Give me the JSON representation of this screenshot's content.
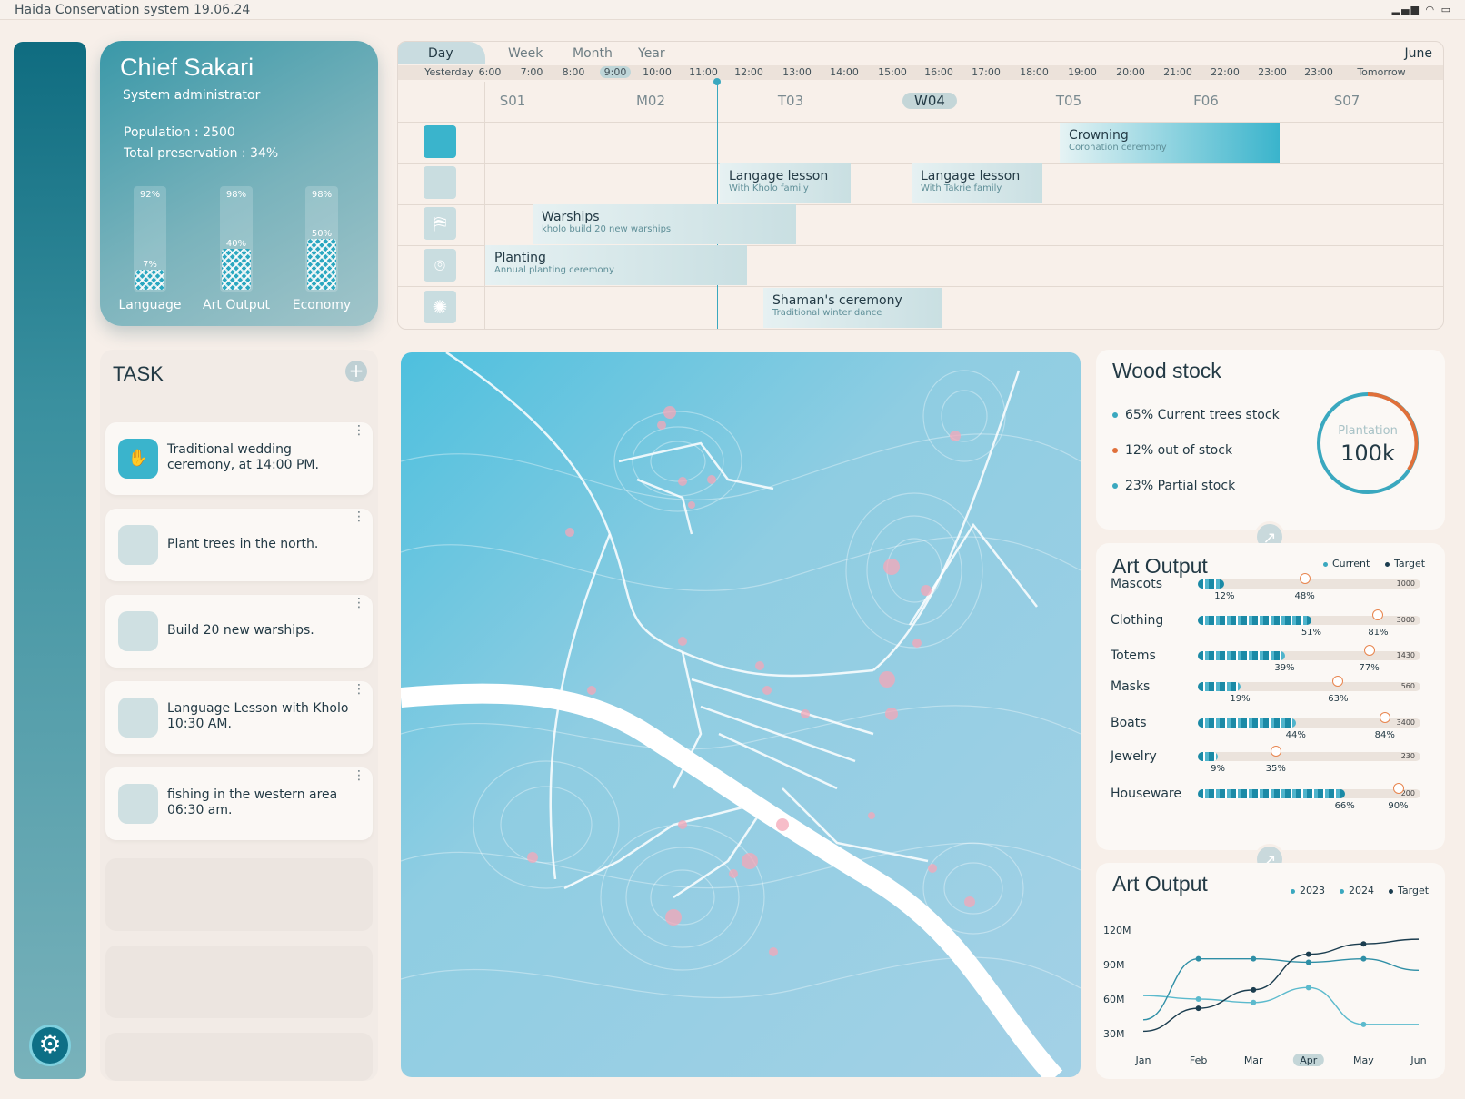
{
  "app_title": "Haida Conservation system 19.06.24",
  "profile": {
    "name": "Chief Sakari",
    "role": "System administrator",
    "population": "Population : 2500",
    "preservation": "Total preservation : 34%",
    "stats": [
      {
        "label": "Language",
        "top": "92%",
        "value": "7%",
        "fill": 7
      },
      {
        "label": "Art Output",
        "top": "98%",
        "value": "40%",
        "fill": 40
      },
      {
        "label": "Economy",
        "top": "98%",
        "value": "50%",
        "fill": 50
      }
    ]
  },
  "timeline": {
    "tabs": [
      "Day",
      "Week",
      "Month",
      "Year"
    ],
    "month": "June",
    "hours": [
      "Yesterday",
      "6:00",
      "7:00",
      "8:00",
      "9:00",
      "10:00",
      "11:00",
      "12:00",
      "13:00",
      "14:00",
      "15:00",
      "16:00",
      "17:00",
      "18:00",
      "19:00",
      "20:00",
      "21:00",
      "22:00",
      "23:00",
      "23:00",
      "Tomorrow"
    ],
    "active_hour": "9:00",
    "days": [
      "S01",
      "M02",
      "T03",
      "W04",
      "T05",
      "F06",
      "S07"
    ],
    "active_day": "W04",
    "events": [
      {
        "title": "Crowning",
        "sub": "Coronation ceremony"
      },
      {
        "title": "Langage lesson",
        "sub": "With Kholo family"
      },
      {
        "title": "Langage lesson",
        "sub": "With Takrie family"
      },
      {
        "title": "Warships",
        "sub": "kholo build 20 new warships"
      },
      {
        "title": "Planting",
        "sub": "Annual planting ceremony"
      },
      {
        "title": "Shaman's ceremony",
        "sub": "Traditional winter dance"
      }
    ]
  },
  "tasks": {
    "title": "TASK",
    "items": [
      "Traditional wedding ceremony, at 14:00 PM.",
      "Plant trees in the north.",
      "Build 20 new warships.",
      "Language Lesson with Kholo 10:30 AM.",
      "fishing in the western area 06:30 am."
    ]
  },
  "wood": {
    "title": "Wood stock",
    "items": [
      {
        "pct": "65%",
        "label": "Current trees stock",
        "color": "#3aa8bf"
      },
      {
        "pct": "12%",
        "label": "out of stock",
        "color": "#e0703a"
      },
      {
        "pct": "23%",
        "label": "Partial stock",
        "color": "#3aa8bf"
      }
    ],
    "ring_label": "Plantation",
    "ring_value": "100k"
  },
  "art_output": {
    "title": "Art Output",
    "legend_current": "Current",
    "legend_target": "Target",
    "rows": [
      {
        "label": "Mascots",
        "current": "12%",
        "target": "48%",
        "max": "1000",
        "c": 12,
        "t": 48
      },
      {
        "label": "Clothing",
        "current": "51%",
        "target": "81%",
        "max": "3000",
        "c": 51,
        "t": 81
      },
      {
        "label": "Totems",
        "current": "39%",
        "target": "77%",
        "max": "1430",
        "c": 39,
        "t": 77
      },
      {
        "label": "Masks",
        "current": "19%",
        "target": "63%",
        "max": "560",
        "c": 19,
        "t": 63
      },
      {
        "label": "Boats",
        "current": "44%",
        "target": "84%",
        "max": "3400",
        "c": 44,
        "t": 84
      },
      {
        "label": "Jewelry",
        "current": "9%",
        "target": "35%",
        "max": "230",
        "c": 9,
        "t": 35
      },
      {
        "label": "Houseware",
        "current": "66%",
        "target": "90%",
        "max": "200",
        "c": 66,
        "t": 90
      }
    ]
  },
  "art_chart": {
    "title": "Art Output",
    "legend": [
      "2023",
      "2024",
      "Target"
    ],
    "colors": {
      "2023": "#3aa8bf",
      "2024": "#3aa8bf",
      "Target": "#1b3d4f"
    },
    "chart_data": {
      "type": "line",
      "categories": [
        "Jan",
        "Feb",
        "Mar",
        "Apr",
        "May",
        "Jun"
      ],
      "active_category": "Apr",
      "y_ticks": [
        "120M",
        "90M",
        "60M",
        "30M"
      ],
      "ylim": [
        30,
        120
      ],
      "series": [
        {
          "name": "2023",
          "values": [
            63,
            60,
            57,
            70,
            38,
            38
          ]
        },
        {
          "name": "2024",
          "values": [
            42,
            95,
            95,
            92,
            95,
            85
          ]
        },
        {
          "name": "Target",
          "values": [
            32,
            52,
            68,
            99,
            108,
            112
          ]
        }
      ]
    }
  }
}
